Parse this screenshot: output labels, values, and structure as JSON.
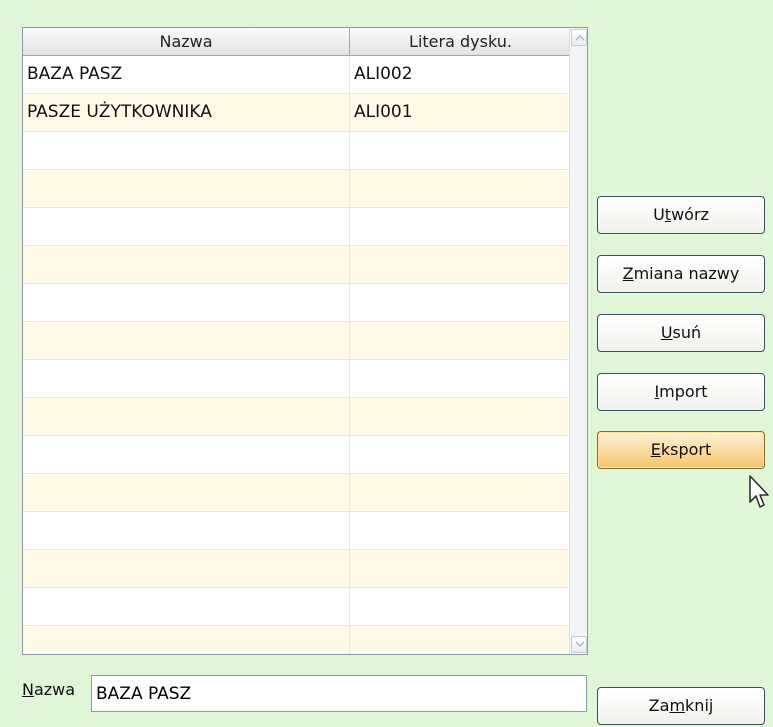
{
  "table": {
    "columns": [
      "Nazwa",
      "Litera dysku."
    ],
    "rows": [
      {
        "name": "BAZA PASZ",
        "drive": "ALI002"
      },
      {
        "name": "PASZE UŻYTKOWNIKA",
        "drive": "ALI001"
      }
    ],
    "empty_rows": 14
  },
  "buttons": {
    "create": {
      "pre": "U",
      "ul": "t",
      "post": "wórz"
    },
    "rename": {
      "pre": "",
      "ul": "Z",
      "post": "miana nazwy"
    },
    "delete": {
      "pre": "",
      "ul": "U",
      "post": "suń"
    },
    "import": {
      "pre": "",
      "ul": "I",
      "post": "mport"
    },
    "export": {
      "pre": "",
      "ul": "E",
      "post": "ksport"
    },
    "close": {
      "pre": "Za",
      "ul": "m",
      "post": "knij"
    }
  },
  "name_field": {
    "label_ul": "N",
    "label_rest": "azwa",
    "value": "BAZA PASZ"
  },
  "colors": {
    "background": "#dff7d7",
    "row_alt": "#fffbe6",
    "focus_button": "#f5c46c"
  },
  "icons": {
    "scroll_up": "chevron-up-icon",
    "scroll_down": "chevron-down-icon",
    "cursor": "mouse-pointer-icon"
  }
}
